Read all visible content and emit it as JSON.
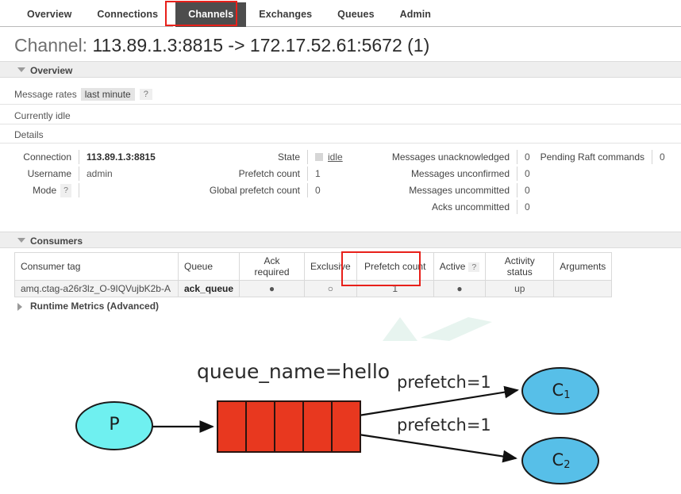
{
  "nav": {
    "items": [
      {
        "label": "Overview",
        "active": false
      },
      {
        "label": "Connections",
        "active": false
      },
      {
        "label": "Channels",
        "active": true
      },
      {
        "label": "Exchanges",
        "active": false
      },
      {
        "label": "Queues",
        "active": false
      },
      {
        "label": "Admin",
        "active": false
      }
    ],
    "highlight_color": "#e8201a",
    "active_bg": "#4d4d4d"
  },
  "title": {
    "label": "Channel:",
    "value": "113.89.1.3:8815 -> 172.17.52.61:5672 (1)"
  },
  "sections": {
    "overview": "Overview",
    "consumers": "Consumers",
    "runtime_metrics": "Runtime Metrics (Advanced)"
  },
  "overview": {
    "message_rates_label": "Message rates",
    "message_rates_period": "last minute",
    "help_glyph": "?",
    "idle_text": "Currently idle",
    "details_label": "Details",
    "col1": [
      {
        "key": "Connection",
        "value": "113.89.1.3:8815",
        "bold": true
      },
      {
        "key": "Username",
        "value": "admin",
        "bold": false
      },
      {
        "key": "Mode",
        "value": "",
        "help": true
      }
    ],
    "col2": [
      {
        "key": "State",
        "value": "idle",
        "state": true
      },
      {
        "key": "Prefetch count",
        "value": "1"
      },
      {
        "key": "Global prefetch count",
        "value": "0"
      }
    ],
    "col3": [
      {
        "key": "Messages unacknowledged",
        "value": "0"
      },
      {
        "key": "Messages unconfirmed",
        "value": "0"
      },
      {
        "key": "Messages uncommitted",
        "value": "0"
      },
      {
        "key": "Acks uncommitted",
        "value": "0"
      }
    ],
    "col4": [
      {
        "key": "Pending Raft commands",
        "value": "0"
      }
    ]
  },
  "consumers_table": {
    "headers": [
      "Consumer tag",
      "Queue",
      "Ack required",
      "Exclusive",
      "Prefetch count",
      "Active",
      "Activity status",
      "Arguments"
    ],
    "active_help": "?",
    "rows": [
      {
        "consumer_tag": "amq.ctag-a26r3lz_O-9IQVujbK2b-A",
        "queue": "ack_queue",
        "ack_required": "●",
        "exclusive": "○",
        "prefetch_count": "1",
        "active": "●",
        "activity_status": "up",
        "arguments": ""
      }
    ]
  },
  "diagram": {
    "queue_name_label": "queue_name=hello",
    "producer_label": "P",
    "consumer1_label": "C",
    "consumer1_sub": "1",
    "consumer2_label": "C",
    "consumer2_sub": "2",
    "prefetch_label_top": "prefetch=1",
    "prefetch_label_bottom": "prefetch=1",
    "queue_cell_count": 5,
    "colors": {
      "producer_fill": "#6ff0f0",
      "consumer_fill": "#57bfe8",
      "queue_fill": "#e8381f",
      "stroke": "#1a1a1a"
    }
  }
}
